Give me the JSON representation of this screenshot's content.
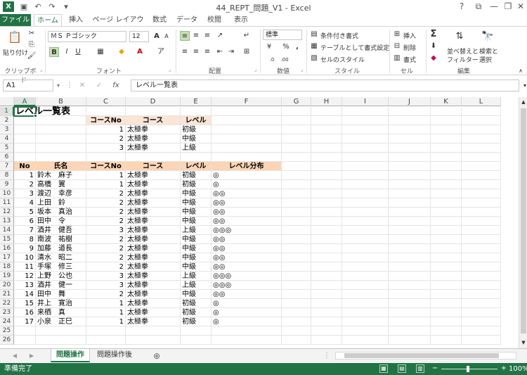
{
  "window": {
    "title": "44_REPT_問題_V1 - Excel",
    "app_icon": "X",
    "help": "?",
    "ribbon_display": "⧉",
    "minimize": "—",
    "maximize": "❐",
    "close": "✕"
  },
  "quick_access": {
    "save": "💾",
    "undo": "↶",
    "redo": "↷",
    "customize": "▾"
  },
  "tabs": [
    "ファイル",
    "ホーム",
    "挿入",
    "ページ レイアウト",
    "数式",
    "データ",
    "校閲",
    "表示"
  ],
  "ribbon": {
    "paste": "貼り付け",
    "font_name": "ＭＳ Ｐゴシック",
    "font_size": "12",
    "grow": "A",
    "shrink": "A",
    "bold": "B",
    "italic": "I",
    "underline": "U",
    "number_format": "標準",
    "percent": "%",
    "comma": ",",
    "conditional_format": "条件付き書式",
    "format_as_table": "テーブルとして書式設定",
    "cell_styles": "セルのスタイル",
    "insert": "挿入",
    "delete": "削除",
    "format": "書式",
    "sort_filter_1": "並べ替えと",
    "sort_filter_2": "フィルター",
    "find_select_1": "検索と",
    "find_select_2": "選択",
    "sum": "Σ",
    "groups": [
      "クリップボード",
      "フォント",
      "配置",
      "数値",
      "スタイル",
      "セル",
      "編集"
    ]
  },
  "formula_bar": {
    "name_box": "A1",
    "fx": "fx",
    "cancel": "✕",
    "enter": "✓",
    "formula": "レベル一覧表"
  },
  "grid": {
    "columns": [
      "A",
      "B",
      "C",
      "D",
      "E",
      "F",
      "G",
      "H",
      "I",
      "J",
      "K",
      "L"
    ],
    "rows": [
      "1",
      "2",
      "3",
      "4",
      "5",
      "6",
      "7",
      "8",
      "9",
      "10",
      "11",
      "12",
      "13",
      "14",
      "15",
      "16",
      "17",
      "18",
      "19",
      "20",
      "21",
      "22",
      "23",
      "24",
      "25",
      "26"
    ],
    "title": "レベル一覧表",
    "master_header": [
      "コースNo",
      "コース",
      "レベル"
    ],
    "master_rows": [
      [
        "1",
        "太極拳",
        "初級"
      ],
      [
        "2",
        "太極拳",
        "中級"
      ],
      [
        "3",
        "太極拳",
        "上級"
      ]
    ],
    "list_header": [
      "No",
      "氏名",
      "コースNo",
      "コース",
      "レベル",
      "レベル分布"
    ],
    "list_rows": [
      [
        "1",
        "鈴木　麻子",
        "1",
        "太極拳",
        "初級",
        "◎"
      ],
      [
        "2",
        "高橋　翼",
        "1",
        "太極拳",
        "初級",
        "◎"
      ],
      [
        "3",
        "渡辺　幸彦",
        "2",
        "太極拳",
        "中級",
        "◎◎"
      ],
      [
        "4",
        "上田　鈴",
        "2",
        "太極拳",
        "中級",
        "◎◎"
      ],
      [
        "5",
        "坂本　真治",
        "2",
        "太極拳",
        "中級",
        "◎◎"
      ],
      [
        "6",
        "田中　令",
        "2",
        "太極拳",
        "中級",
        "◎◎"
      ],
      [
        "7",
        "酒井　健吾",
        "3",
        "太極拳",
        "上級",
        "◎◎◎"
      ],
      [
        "8",
        "南波　祐樹",
        "2",
        "太極拳",
        "中級",
        "◎◎"
      ],
      [
        "9",
        "加藤　道長",
        "2",
        "太極拳",
        "中級",
        "◎◎"
      ],
      [
        "10",
        "清水　昭二",
        "2",
        "太極拳",
        "中級",
        "◎◎"
      ],
      [
        "11",
        "手塚　修三",
        "2",
        "太極拳",
        "中級",
        "◎◎"
      ],
      [
        "12",
        "上野　公也",
        "3",
        "太極拳",
        "上級",
        "◎◎◎"
      ],
      [
        "13",
        "酒井　健一",
        "3",
        "太極拳",
        "上級",
        "◎◎◎"
      ],
      [
        "14",
        "田中　舞",
        "2",
        "太極拳",
        "中級",
        "◎◎"
      ],
      [
        "15",
        "井上　寛治",
        "1",
        "太極拳",
        "初級",
        "◎"
      ],
      [
        "16",
        "来栖　真",
        "1",
        "太極拳",
        "初級",
        "◎"
      ],
      [
        "17",
        "小泉　正巳",
        "1",
        "太極拳",
        "初級",
        "◎"
      ]
    ]
  },
  "sheets": [
    "問題操作",
    "問題操作後"
  ],
  "add_sheet": "⊕",
  "status": {
    "ready": "準備完了",
    "zoom": "100%",
    "zoom_minus": "−",
    "zoom_plus": "+"
  },
  "colors": {
    "excel_green": "#217346",
    "header_fill": "#fce4d6"
  }
}
